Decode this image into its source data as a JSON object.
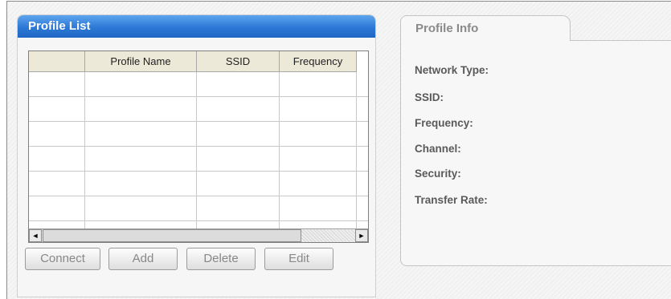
{
  "profile_list": {
    "title": "Profile List",
    "columns": [
      "",
      "Profile Name",
      "SSID",
      "Frequency"
    ],
    "rows": [
      [
        "",
        "",
        "",
        ""
      ],
      [
        "",
        "",
        "",
        ""
      ],
      [
        "",
        "",
        "",
        ""
      ],
      [
        "",
        "",
        "",
        ""
      ],
      [
        "",
        "",
        "",
        ""
      ],
      [
        "",
        "",
        "",
        ""
      ]
    ],
    "scroll_left_glyph": "◄",
    "scroll_right_glyph": "►"
  },
  "buttons": {
    "connect": "Connect",
    "add": "Add",
    "delete": "Delete",
    "edit": "Edit"
  },
  "profile_info": {
    "tab_title": "Profile Info",
    "labels": {
      "network_type": "Network Type:",
      "ssid": "SSID:",
      "frequency": "Frequency:",
      "channel": "Channel:",
      "security": "Security:",
      "transfer_rate": "Transfer Rate:"
    }
  }
}
